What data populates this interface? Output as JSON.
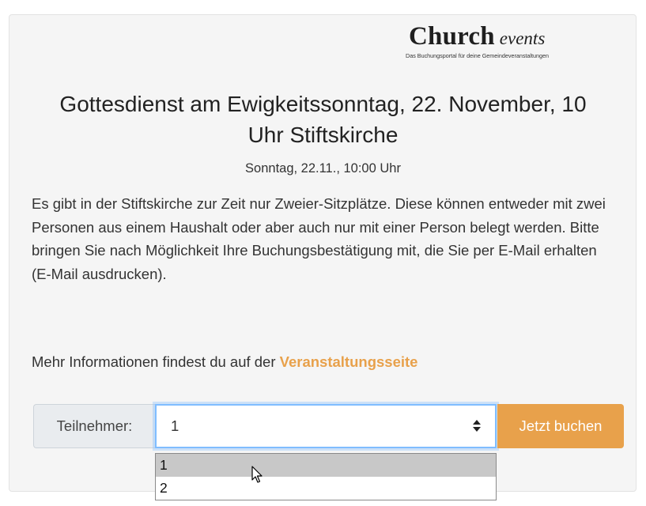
{
  "logo": {
    "brand": "Church",
    "suffix": "events",
    "tagline": "Das Buchungsportal für deine Gemeindeveranstaltungen"
  },
  "event": {
    "title": "Gottesdienst am Ewigkeitssonntag, 22. November, 10 Uhr Stiftskirche",
    "date": "Sonntag, 22.11., 10:00 Uhr",
    "description": "Es gibt in der Stiftskirche zur Zeit nur Zweier-Sitzplätze. Diese können entweder mit zwei Personen aus einem Haushalt oder aber auch nur mit einer Person belegt werden. Bitte bringen Sie nach Möglichkeit Ihre Buchungsbestätigung mit, die Sie per E-Mail erhalten (E-Mail ausdrucken).",
    "more_info_text": "Mehr Informationen findest du auf der",
    "more_info_link": "Veranstaltungsseite"
  },
  "booking": {
    "participants_label": "Teilnehmer:",
    "selected_value": "1",
    "options": [
      "1",
      "2"
    ],
    "book_button": "Jetzt buchen"
  },
  "colors": {
    "accent": "#e8a14b",
    "focus_border": "#80bdff"
  }
}
